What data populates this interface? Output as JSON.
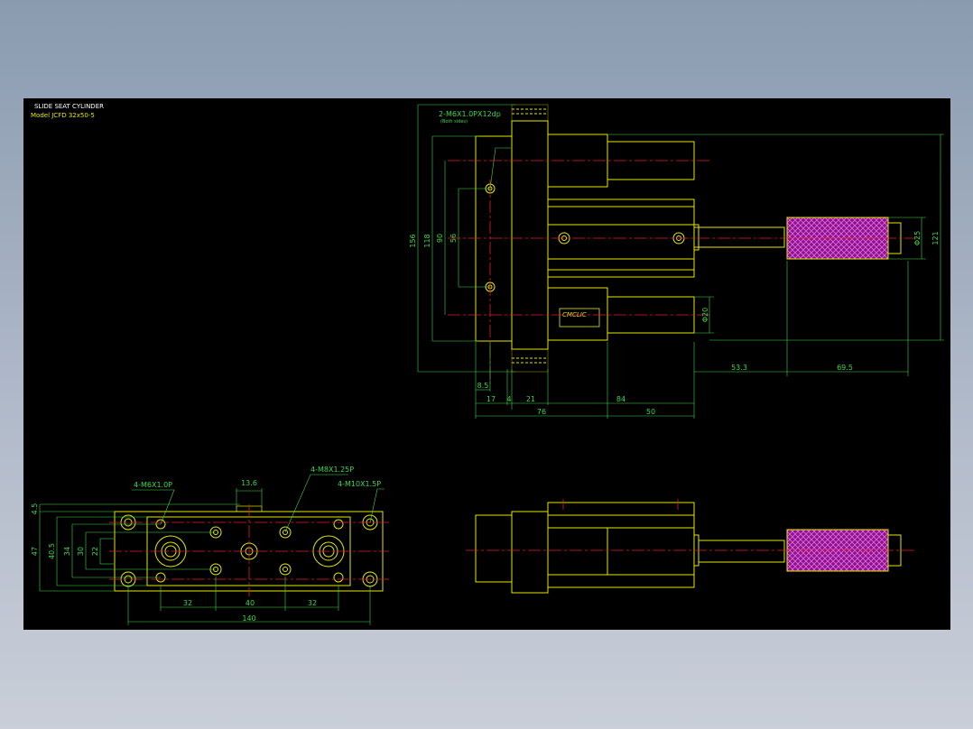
{
  "title_block": {
    "line1": "SLIDE SEAT CYLINDER",
    "line2": "Model  JCFD 32x50-5"
  },
  "top_view": {
    "callout": "2-M6X1.0PX12dp",
    "callout_sub": "(Both sides)",
    "brand": "CMCLIC",
    "dims": {
      "d156": "156",
      "d118": "118",
      "d90": "90",
      "d56": "56",
      "d8_5": "8.5",
      "d17": "17",
      "d4": "4",
      "d21": "21",
      "d84": "84",
      "d76": "76",
      "d50": "50",
      "d53_3": "53.3",
      "d69_5": "69.5",
      "d121": "121",
      "dphi25": "Φ25",
      "dphi20": "Φ20"
    }
  },
  "bottom_view": {
    "callout_m6": "4-M6X1.0P",
    "callout_m8": "4-M8X1.25P",
    "callout_m10": "4-M10X1.5P",
    "dims": {
      "d13_6": "13.6",
      "d4_5": "4.5",
      "d47": "47",
      "d40_5": "40.5",
      "d34": "34",
      "d30": "30",
      "d22": "22",
      "d32a": "32",
      "d40": "40",
      "d32b": "32",
      "d140": "140"
    }
  },
  "colors": {
    "background": "#000000",
    "outline": "#e6e600",
    "dimension": "#3fd64a",
    "centerline": "#e0202a",
    "knurl": "#cc33cc",
    "text": "#ffffff"
  }
}
